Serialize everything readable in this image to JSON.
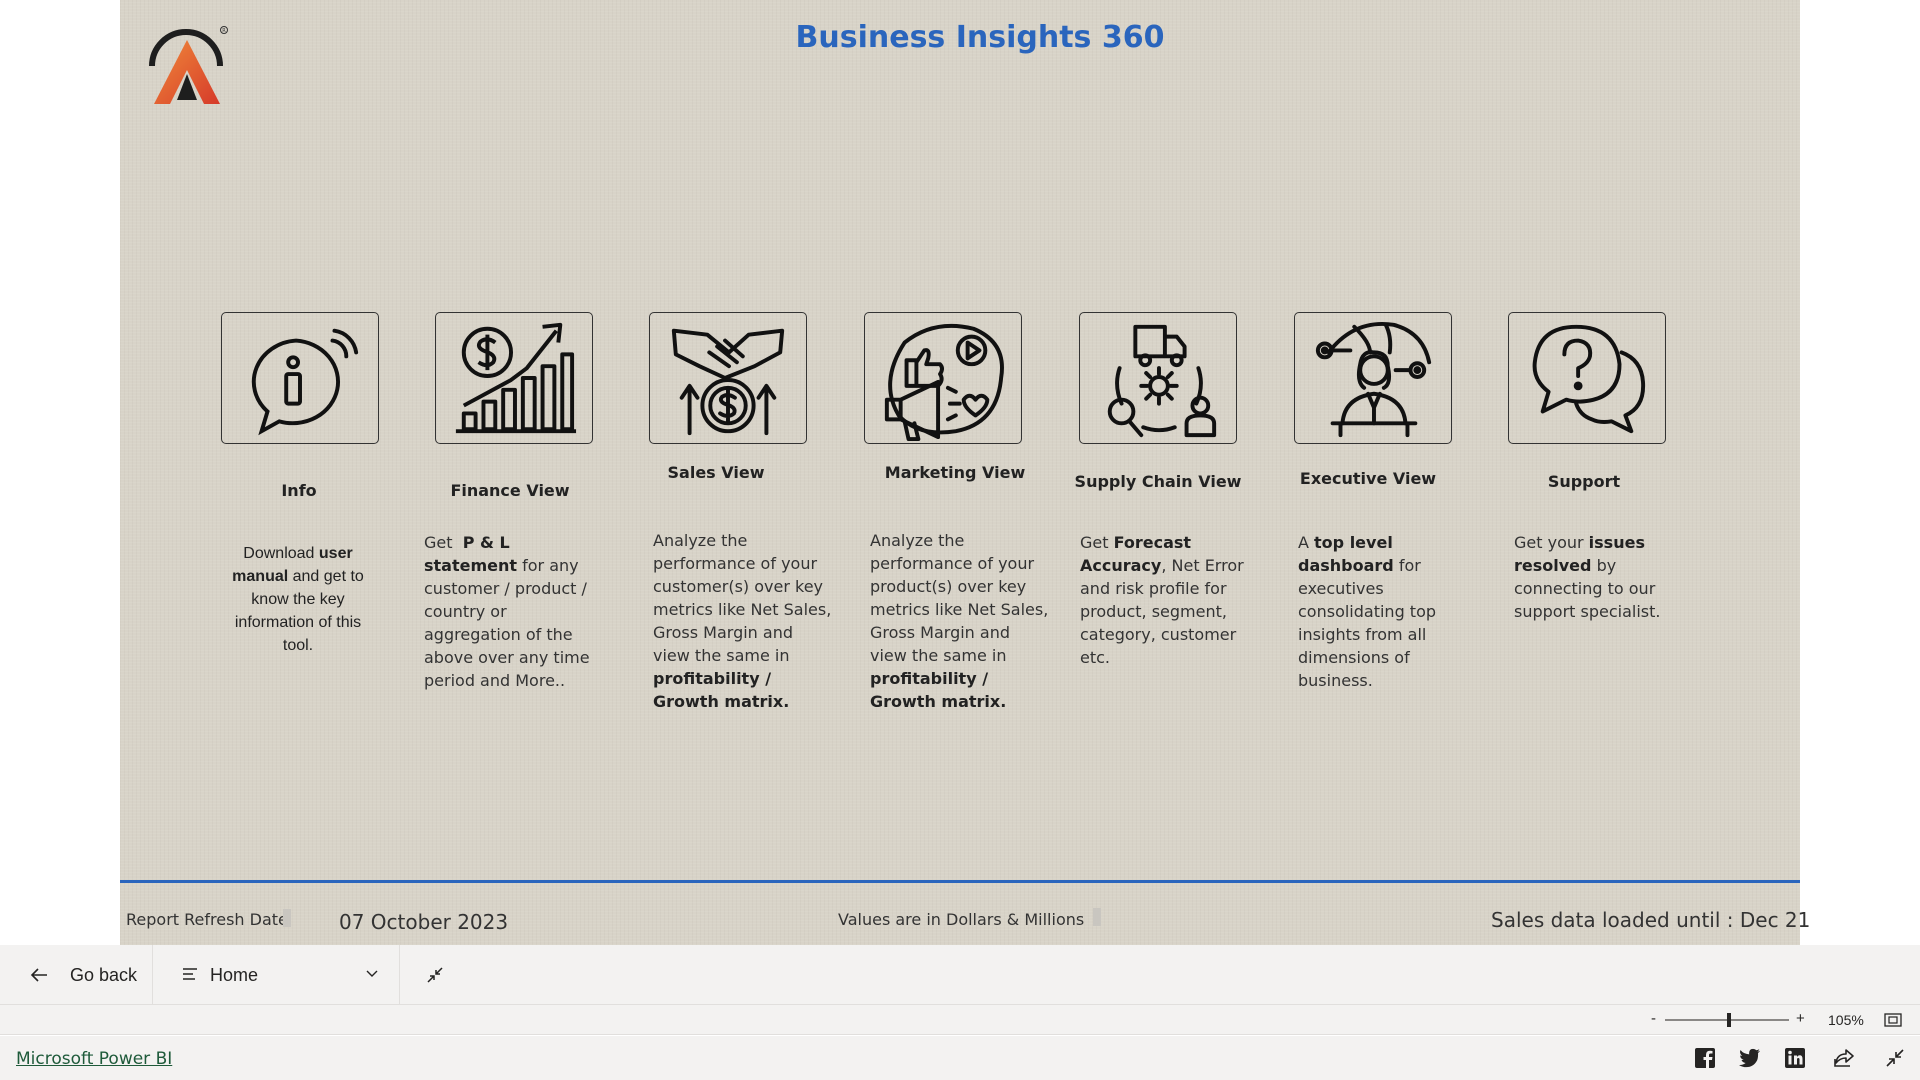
{
  "header": {
    "title": "Business Insights 360"
  },
  "cards": [
    {
      "title": "Info",
      "icon": "info-icon",
      "desc_html": "Download <b>user manual</b> and get to know the key information of this tool."
    },
    {
      "title": "Finance View",
      "icon": "finance-chart-icon",
      "desc_html": "Get&nbsp; <b>P &amp; L statement</b> for any customer / product / country or aggregation of the above over any time period and More.."
    },
    {
      "title": "Sales View",
      "icon": "handshake-dollar-icon",
      "desc_html": "Analyze the performance of your customer(s) over key metrics like Net Sales, Gross Margin and view the same in <b>profitability / Growth matrix.</b>"
    },
    {
      "title": "Marketing View",
      "icon": "megaphone-social-icon",
      "desc_html": "Analyze the performance of your product(s) over key metrics like Net Sales, Gross Margin and view the same in <b>profitability / Growth matrix.</b>"
    },
    {
      "title": "Supply Chain View",
      "icon": "supply-chain-icon",
      "desc_html": "Get <b>Forecast Accuracy</b>, Net Error and risk profile for product, segment, category, customer etc."
    },
    {
      "title": "Executive View",
      "icon": "executive-icon",
      "desc_html": "A <b>top level dashboard</b> for executives consolidating top insights from all dimensions of business."
    },
    {
      "title": "Support",
      "icon": "support-chat-icon",
      "desc_html": "Get your <b>issues resolved</b> by connecting to our support specialist."
    }
  ],
  "footer": {
    "refresh_label": "Report Refresh Date",
    "refresh_date": "07 October 2023",
    "values_note": "Values are in Dollars & Millions",
    "sales_loaded": "Sales data loaded until : Dec 21"
  },
  "navbar": {
    "back_label": "Go back",
    "page_label": "Home"
  },
  "zoom": {
    "minus": "-",
    "plus": "+",
    "level": "105%",
    "level_percent": 105
  },
  "bottom": {
    "brand_link": "Microsoft Power BI"
  },
  "colors": {
    "title": "#2a65bd",
    "canvas": "#d8d3c8",
    "divider": "#2a65bd",
    "logo_orange": "#e8552a"
  }
}
